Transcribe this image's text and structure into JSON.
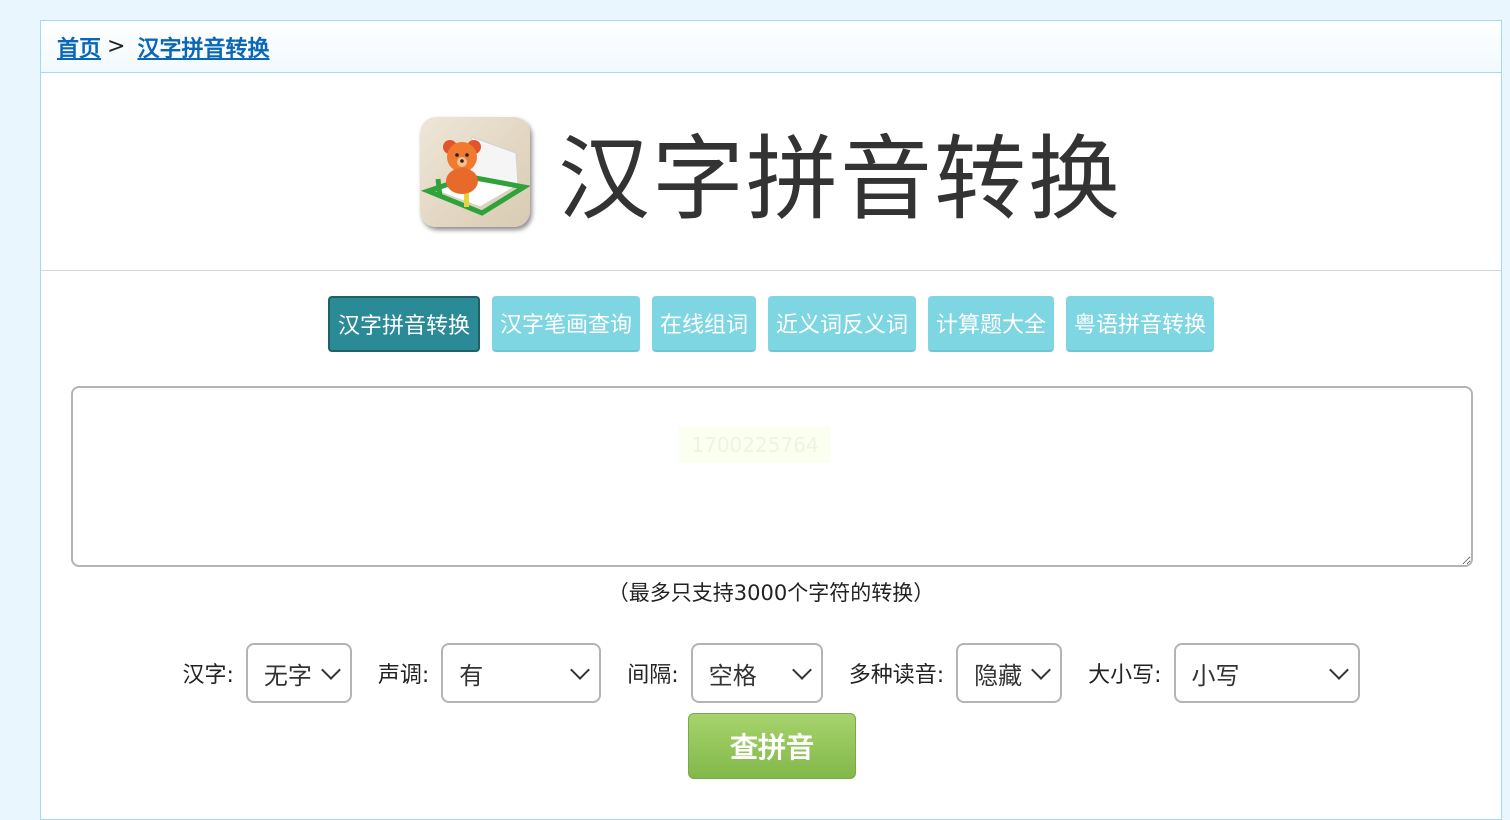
{
  "breadcrumb": {
    "home": "首页",
    "separator": ">",
    "current": "汉字拼音转换"
  },
  "header": {
    "title": "汉字拼音转换",
    "logo_icon": "teddy-bear-book-icon"
  },
  "tabs": [
    {
      "label": "汉字拼音转换",
      "active": true
    },
    {
      "label": "汉字笔画查询",
      "active": false
    },
    {
      "label": "在线组词",
      "active": false
    },
    {
      "label": "近义词反义词",
      "active": false
    },
    {
      "label": "计算题大全",
      "active": false
    },
    {
      "label": "粤语拼音转换",
      "active": false
    }
  ],
  "input": {
    "value": "",
    "watermark": "1700225764"
  },
  "hint": "（最多只支持3000个字符的转换）",
  "options": {
    "hanzi": {
      "label": "汉字:",
      "value": "无字"
    },
    "tone": {
      "label": "声调:",
      "value": "有"
    },
    "spacing": {
      "label": "间隔:",
      "value": "空格"
    },
    "polyphone": {
      "label": "多种读音:",
      "value": "隐藏"
    },
    "case": {
      "label": "大小写:",
      "value": "小写"
    }
  },
  "submit_label": "查拼音",
  "colors": {
    "page_bg": "#eaf6fd",
    "frame_border": "#9fdcf2",
    "link": "#0a67b8",
    "tab_active": "#2a8a96",
    "tab_inactive": "#7ed6e2",
    "submit": "#96c65c"
  }
}
